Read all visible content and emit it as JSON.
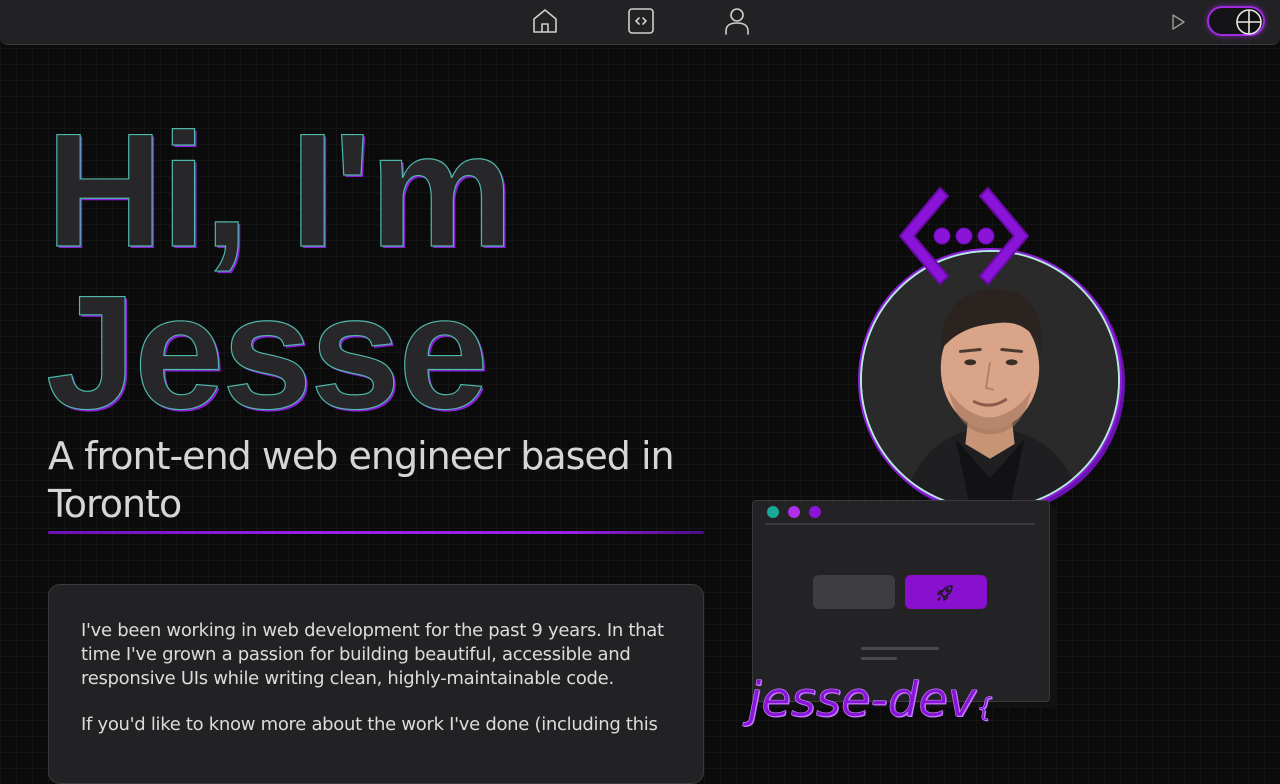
{
  "nav": {
    "items": [
      {
        "name": "home",
        "icon": "home-icon"
      },
      {
        "name": "code",
        "icon": "code-icon"
      },
      {
        "name": "profile",
        "icon": "user-icon"
      }
    ],
    "play_icon": "play-icon",
    "theme_toggle_icon": "globe-icon"
  },
  "hero": {
    "line1": "Hi, I'm",
    "line2": "Jesse",
    "subtitle": "A front-end web engineer based in Toronto"
  },
  "about": {
    "paragraphs": [
      "I've been working in web development for the past 9 years. In that time I've grown a passion for building beautiful, accessible and responsive UIs while writing clean, highly-maintainable code.",
      "If you'd like to know more about the work I've done (including this"
    ]
  },
  "illustration": {
    "brand": "jesse-dev",
    "brand_suffix": "{",
    "logo_icon": "code-ellipsis-icon",
    "rocket_icon": "rocket-icon"
  },
  "colors": {
    "accent": "#8a14d8",
    "teal": "#1aa89a",
    "background": "#0b0b0c",
    "panel": "#222224"
  }
}
